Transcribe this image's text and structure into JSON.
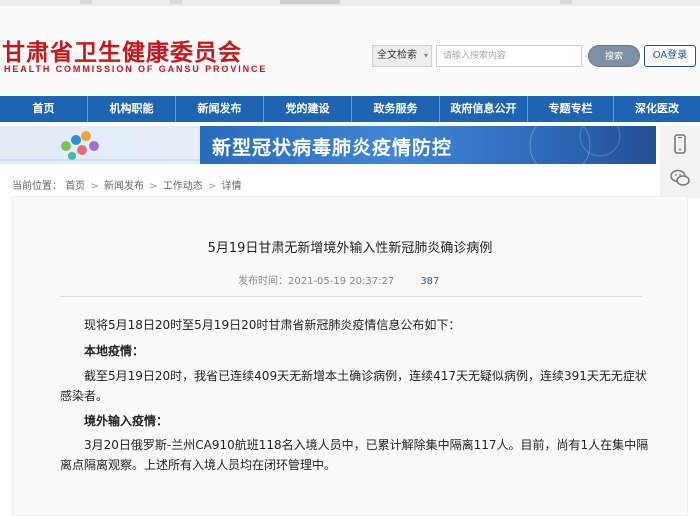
{
  "site": {
    "name_cn": "甘肃省卫生健康委员会",
    "name_en": "HEALTH COMMISSION OF GANSU PROVINCE"
  },
  "search": {
    "scope": "全文检索",
    "placeholder": "请输入搜索内容",
    "button": "搜索",
    "oa": "OA登录"
  },
  "nav": {
    "items": [
      "首页",
      "机构职能",
      "新闻发布",
      "党的建设",
      "政务服务",
      "政府信息公开",
      "专题专栏",
      "深化医改"
    ]
  },
  "banner": {
    "title": "新型冠状病毒肺炎疫情防控"
  },
  "breadcrumb": {
    "label": "当前位置：",
    "items": [
      "首页",
      "新闻发布",
      "工作动态",
      "详情"
    ]
  },
  "article": {
    "title": "5月19日甘肃无新增境外输入性新冠肺炎确诊病例",
    "publish_label": "发布时间：",
    "publish_time": "2021-05-19 20:37:27",
    "views": "387",
    "paragraphs": [
      "现将5月18日20时至5月19日20时甘肃省新冠肺炎疫情信息公布如下：",
      "本地疫情：",
      "截至5月19日20时，我省已连续409天无新增本土确诊病例，连续417天无疑似病例，连续391天无无症状感染者。",
      "境外输入疫情：",
      "3月20日俄罗斯-兰州CA910航班118名入境人员中，已累计解除集中隔离117人。目前，尚有1人在集中隔离点隔离观察。上述所有入境人员均在闭环管理中。"
    ]
  },
  "colors": {
    "brand_red": "#c8161d",
    "nav_blue": "#1d64b3",
    "link_blue": "#1d5fb0"
  },
  "icons": {
    "side_tool_1": "mobile-phone-icon",
    "side_tool_2": "wechat-icon"
  }
}
